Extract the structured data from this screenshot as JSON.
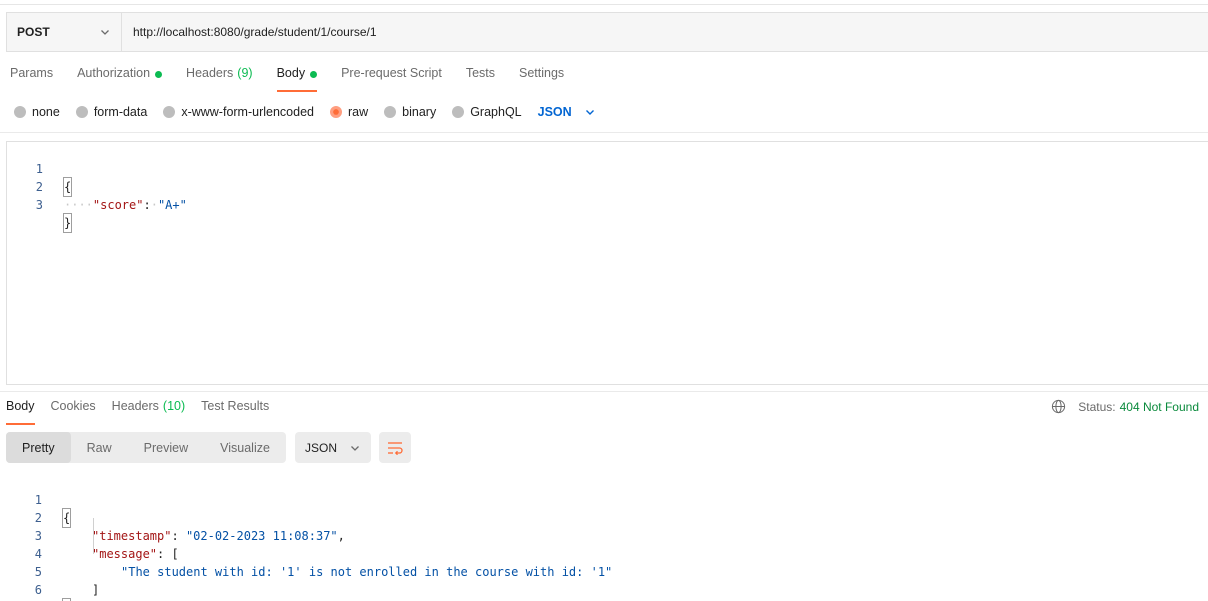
{
  "request": {
    "method": "POST",
    "url": "http://localhost:8080/grade/student/1/course/1"
  },
  "request_tabs": [
    {
      "label": "Params"
    },
    {
      "label": "Authorization"
    },
    {
      "label": "Headers",
      "count": "(9)"
    },
    {
      "label": "Body"
    },
    {
      "label": "Pre-request Script"
    },
    {
      "label": "Tests"
    },
    {
      "label": "Settings"
    }
  ],
  "body_options": [
    "none",
    "form-data",
    "x-www-form-urlencoded",
    "raw",
    "binary",
    "GraphQL"
  ],
  "body_format": "JSON",
  "request_body": {
    "line_numbers": [
      "1",
      "2",
      "3"
    ],
    "open": "{",
    "indent": "····",
    "key": "\"score\"",
    "colon": ":",
    "value": "\"A+\"",
    "close": "}"
  },
  "response_tabs": [
    {
      "label": "Body"
    },
    {
      "label": "Cookies"
    },
    {
      "label": "Headers",
      "count": "(10)"
    },
    {
      "label": "Test Results"
    }
  ],
  "status": {
    "label": "Status:",
    "value": "404 Not Found"
  },
  "view_tabs": [
    "Pretty",
    "Raw",
    "Preview",
    "Visualize"
  ],
  "response_format": "JSON",
  "response_body": {
    "line_numbers": [
      "1",
      "2",
      "3",
      "4",
      "5",
      "6"
    ],
    "open": "{",
    "timestamp_key": "\"timestamp\"",
    "timestamp_value": "\"02-02-2023 11:08:37\"",
    "message_key": "\"message\"",
    "message_open": "[",
    "message_value": "\"The student with id: '1' is not enrolled in the course with id: '1\"",
    "message_close": "]",
    "close": "}"
  },
  "colors": {
    "accent": "#ff6c37",
    "dot_green": "#0cbb52",
    "status_green": "#0a8a3c",
    "link_blue": "#0265d2"
  }
}
